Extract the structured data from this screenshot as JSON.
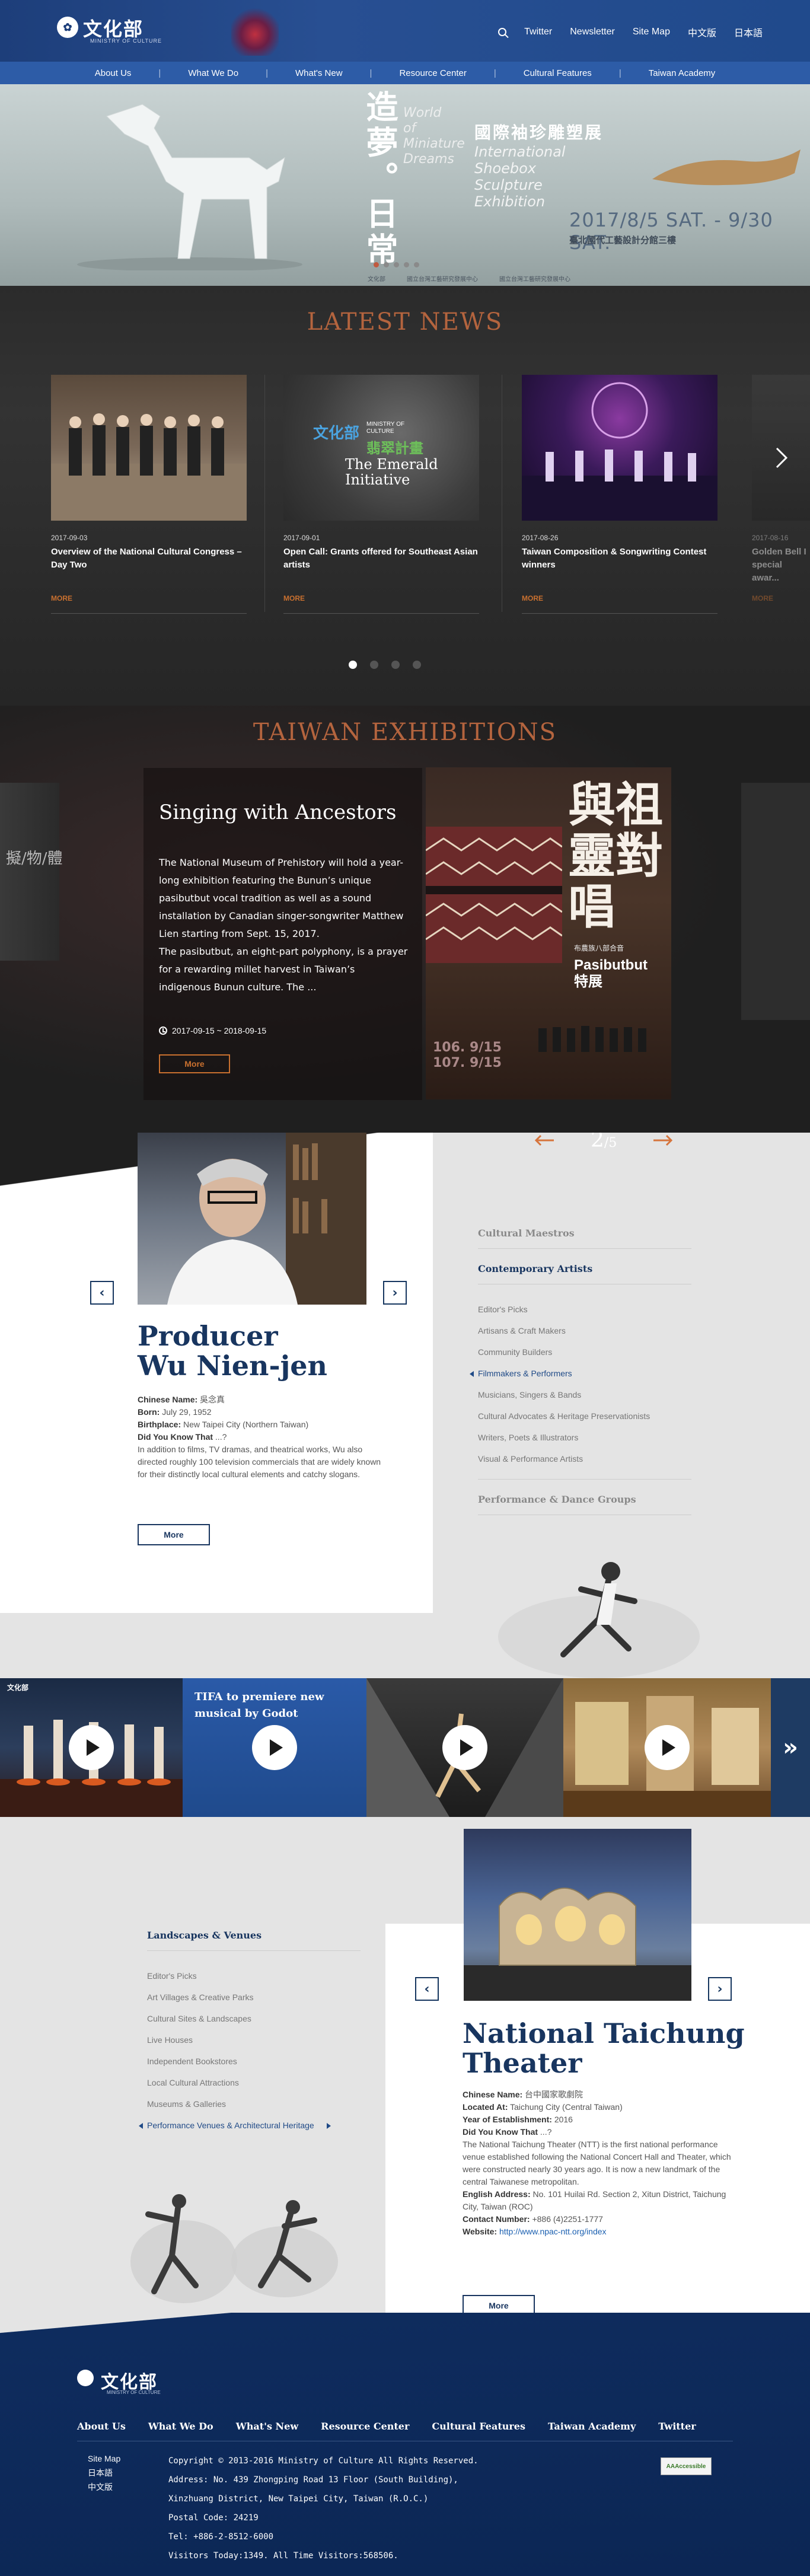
{
  "header": {
    "logo_text": "文化部",
    "logo_sub": "MINISTRY OF CULTURE",
    "links": [
      "Twitter",
      "Newsletter",
      "Site Map",
      "中文版",
      "日本語"
    ]
  },
  "nav": [
    "About Us",
    "What We Do",
    "What's New",
    "Resource Center",
    "Cultural Features",
    "Taiwan Academy"
  ],
  "hero": {
    "title": "造夢。日常",
    "en_lines": [
      "World",
      "of",
      "Miniature",
      "Dreams"
    ],
    "zh_sub": "國際袖珍雕塑展",
    "en_sub_lines": [
      "International",
      "Shoebox",
      "Sculpture",
      "Exhibition"
    ],
    "date": "2017/8/5 SAT. - 9/30 SAT.",
    "venue": "臺北國代工藝設計分館三樓",
    "sponsors": [
      "文化部",
      "國立台灣工藝研究發展中心",
      "國立台灣工藝研究發展中心"
    ]
  },
  "news": {
    "title": "LATEST NEWS",
    "more": "MORE",
    "items": [
      {
        "date": "2017-09-03",
        "title": "Overview of the National Cultural Congress – Day Two"
      },
      {
        "date": "2017-09-01",
        "title": "Open Call: Grants offered for Southeast Asian artists"
      },
      {
        "date": "2017-08-26",
        "title": "Taiwan Composition & Songwriting Contest winners"
      },
      {
        "date": "2017-08-16",
        "title": "Golden Bell I special awar..."
      }
    ],
    "img2_zh": "文化部",
    "img2_ministry": "MINISTRY OF CULTURE",
    "img2_zh2": "翡翠計畫",
    "img2_en": "The Emerald Initiative"
  },
  "exhibitions": {
    "title": "TAIWAN EXHIBITIONS",
    "left_label": "擬/物/體",
    "heading": "Singing with Ancestors",
    "text": "The National Museum of Prehistory will hold a year-long exhibition featuring the Bunun’s unique pasibutbut vocal tradition as well as a sound installation by Canadian singer-songwriter Matthew Lien starting from Sept. 15, 2017.\nThe pasibutbut, an eight-part polyphony, is a prayer for a rewarding millet harvest in Taiwan’s indigenous Bunun culture. The ...",
    "dates": "2017-09-15 ~ 2018-09-15",
    "more": "More",
    "poster_zh": "與祖靈對唱",
    "poster_en1": "Pasibutbut",
    "poster_en2": "特展",
    "poster_small": "布農族八部合音",
    "poster_dates": [
      "106. 9/15",
      "107. 9/15"
    ],
    "page_current": "2",
    "page_total": "/5"
  },
  "maestros": {
    "name_line1": "Producer",
    "name_line2": "Wu Nien-jen",
    "details": [
      {
        "label": "Chinese Name:",
        "value": "吳念真"
      },
      {
        "label": "Born:",
        "value": "July 29, 1952"
      },
      {
        "label": "Birthplace:",
        "value": "New Taipei City (Northern Taiwan)"
      },
      {
        "label": "Did You Know That",
        "value": "...?"
      }
    ],
    "description": "In addition to films, TV dramas, and theatrical works, Wu also directed roughly 100 television commercials that are widely known for their distinctly local cultural elements and catchy slogans.",
    "more": "More",
    "cat_heads": [
      "Cultural Maestros",
      "Contemporary Artists",
      "Performance & Dance Groups"
    ],
    "cat_items": [
      "Editor's Picks",
      "Artisans & Craft Makers",
      "Community Builders",
      "Filmmakers & Performers",
      "Musicians, Singers & Bands",
      "Cultural Advocates & Heritage Preservationists",
      "Writers, Poets & Illustrators",
      "Visual & Performance Artists"
    ]
  },
  "videos": {
    "items": [
      {
        "title": ""
      },
      {
        "title": "TIFA to premiere new musical by Godot"
      },
      {
        "title": ""
      },
      {
        "title": ""
      }
    ],
    "logo": "文化部",
    "more_symbol": "»"
  },
  "venues": {
    "cat_head": "Landscapes & Venues",
    "cat_items": [
      "Editor's Picks",
      "Art Villages & Creative Parks",
      "Cultural Sites & Landscapes",
      "Live Houses",
      "Independent Bookstores",
      "Local Cultural Attractions",
      "Museums & Galleries",
      "Performance Venues & Architectural Heritage"
    ],
    "name_line1": "National Taichung",
    "name_line2": "Theater",
    "details": [
      {
        "label": "Chinese Name:",
        "value": "台中國家歌劇院"
      },
      {
        "label": "Located At:",
        "value": "Taichung City (Central Taiwan)"
      },
      {
        "label": "Year of Establishment:",
        "value": "2016"
      },
      {
        "label": "Did You Know That",
        "value": "...?"
      }
    ],
    "description": "The National Taichung Theater (NTT) is the first national performance venue established following the National Concert Hall and Theater, which were constructed nearly 30 years ago. It is now a new landmark of the central Taiwanese metropolitan.",
    "address_label": "English Address:",
    "address": "No. 101 Huilai Rd. Section 2, Xitun District, Taichung City, Taiwan (ROC)",
    "contact_label": "Contact Number:",
    "contact": "+886 (4)2251-1777",
    "website_label": "Website:",
    "website": "http://www.npac-ntt.org/index",
    "more": "More"
  },
  "footer": {
    "logo": "文化部",
    "logo_sub": "MINISTRY OF CULTURE",
    "nav": [
      "About Us",
      "What We Do",
      "What's New",
      "Resource Center",
      "Cultural Features",
      "Taiwan Academy",
      "Twitter"
    ],
    "side": [
      "Site Map",
      "日本語",
      "中文版"
    ],
    "info": [
      "Copyright © 2013-2016 Ministry of Culture All Rights Reserved.",
      "Address: No. 439 Zhongping Road 13 Floor (South Building),",
      "Xinzhuang District, New Taipei City, Taiwan (R.O.C.)",
      "Postal Code: 24219",
      "Tel: +886-2-8512-6000",
      "Visitors Today:1349. All Time Visitors:568506."
    ],
    "badge": "AAAccessible"
  },
  "colors": {
    "brand_blue": "#284f92",
    "nav_blue": "#2d5ca7",
    "accent_orange": "#c9702f",
    "title_navy": "#18355f"
  }
}
